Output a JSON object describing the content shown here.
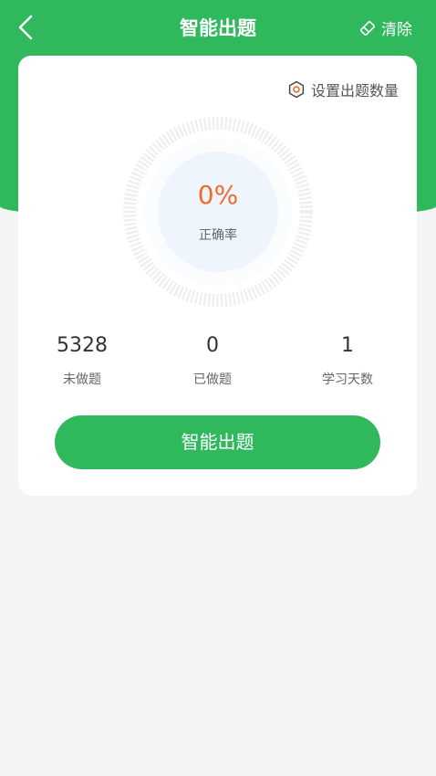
{
  "header": {
    "title": "智能出题",
    "clear_label": "清除"
  },
  "card": {
    "settings_label": "设置出题数量",
    "accuracy": {
      "value": "0%",
      "label": "正确率"
    },
    "stats": [
      {
        "value": "5328",
        "label": "未做题"
      },
      {
        "value": "0",
        "label": "已做题"
      },
      {
        "value": "1",
        "label": "学习天数"
      }
    ],
    "start_button_label": "智能出题"
  },
  "colors": {
    "primary_green": "#2fb95c",
    "accent_orange": "#f26a2b",
    "background": "#f4f4f4"
  }
}
